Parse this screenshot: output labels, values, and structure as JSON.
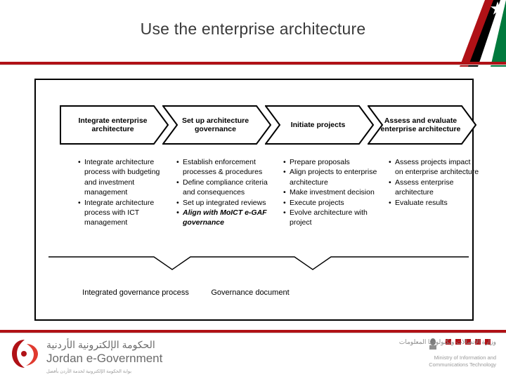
{
  "slide": {
    "title": "Use the enterprise architecture"
  },
  "chevrons": [
    {
      "label": "Integrate enterprise architecture",
      "name": "chevron-integrate-enterprise-architecture"
    },
    {
      "label": "Set up architecture governance",
      "name": "chevron-set-up-architecture-governance"
    },
    {
      "label": "Initiate projects",
      "name": "chevron-initiate-projects"
    },
    {
      "label": "Assess and evaluate enterprise architecture",
      "name": "chevron-assess-and-evaluate-enterprise-architecture"
    }
  ],
  "columns": [
    {
      "name": "bullets-integrate",
      "items": [
        {
          "text": "Integrate architecture process with budgeting and investment management",
          "emphasis": false
        },
        {
          "text": "Integrate architecture process with ICT management",
          "emphasis": false
        }
      ]
    },
    {
      "name": "bullets-governance",
      "items": [
        {
          "text": "Establish enforcement processes &  procedures",
          "emphasis": false
        },
        {
          "text": "Define compliance criteria and consequences",
          "emphasis": false
        },
        {
          "text": "Set up integrated reviews",
          "emphasis": false
        },
        {
          "text": "Align with MoICT e-GAF governance",
          "emphasis": true
        }
      ]
    },
    {
      "name": "bullets-projects",
      "items": [
        {
          "text": "Prepare proposals",
          "emphasis": false
        },
        {
          "text": "Align projects to enterprise architecture",
          "emphasis": false
        },
        {
          "text": "Make investment decision",
          "emphasis": false
        },
        {
          "text": "Execute projects",
          "emphasis": false
        },
        {
          "text": "Evolve architecture with project",
          "emphasis": false
        }
      ]
    },
    {
      "name": "bullets-assess",
      "items": [
        {
          "text": "Assess projects impact on enterprise architecture",
          "emphasis": false
        },
        {
          "text": "Assess enterprise architecture",
          "emphasis": false
        },
        {
          "text": "Evaluate results",
          "emphasis": false
        }
      ]
    }
  ],
  "outputs": [
    {
      "text": "Integrated governance process",
      "name": "output-integrated-governance-process"
    },
    {
      "text": "Governance document",
      "name": "output-governance-document"
    }
  ],
  "footer": {
    "arabic_title": "الحكومة الإلكترونية الأردنية",
    "english_title": "Jordan e-Government",
    "sub_arabic": "بوابة الحكومة الإلكترونية لخدمة الأردن بأفضل",
    "ministry_arabic": "وزارة الاتصالات وتكنولوجيا المعلومات",
    "ministry_english_line1": "Ministry of Information and",
    "ministry_english_line2": "Communications Technology"
  },
  "colors": {
    "accent_red": "#b01116",
    "flag_green": "#007a3d",
    "flag_black": "#000000",
    "text_gray": "#6b6b6b"
  }
}
